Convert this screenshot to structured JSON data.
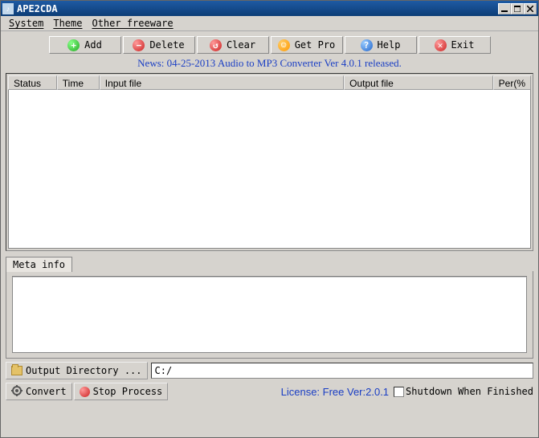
{
  "title": "APE2CDA",
  "menu": {
    "system": "System",
    "theme": "Theme",
    "other": "Other freeware"
  },
  "toolbar": {
    "add": "Add",
    "delete": "Delete",
    "clear": "Clear",
    "getpro": "Get Pro",
    "help": "Help",
    "exit": "Exit"
  },
  "news": "News: 04-25-2013 Audio to MP3 Converter Ver 4.0.1 released.",
  "columns": {
    "status": "Status",
    "time": "Time",
    "input": "Input file",
    "output": "Output file",
    "per": "Per(%"
  },
  "meta_tab": "Meta info",
  "outdir_button": "Output Directory ...",
  "outdir_value": "C:/",
  "convert": "Convert",
  "stop": "Stop Process",
  "license": "License: Free Ver:2.0.1",
  "shutdown": "Shutdown When Finished"
}
